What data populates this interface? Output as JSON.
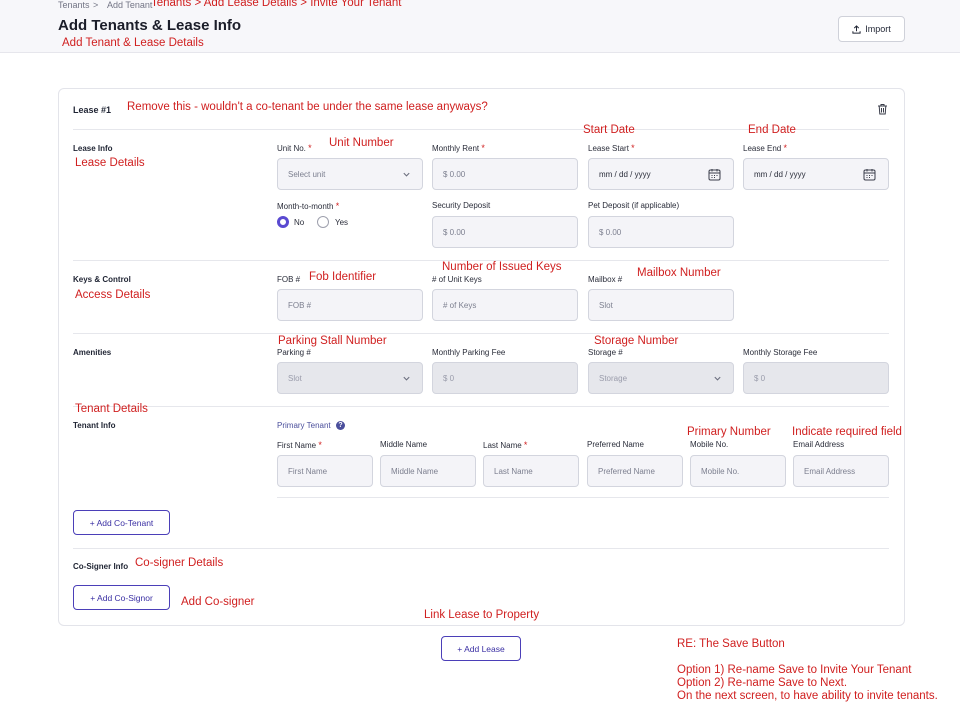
{
  "breadcrumb": {
    "item1": "Tenants",
    "sep": ">",
    "item2": "Add Tenant"
  },
  "header": {
    "title": "Add Tenants & Lease Info",
    "import_label": "Import"
  },
  "lease": {
    "title": "Lease #1",
    "sections": {
      "lease_info": "Lease Info",
      "keys": "Keys & Control",
      "amenities": "Amenities",
      "tenant_info": "Tenant Info",
      "cosigner_info": "Co-Signer Info"
    },
    "fields": {
      "unit": {
        "label": "Unit No.",
        "placeholder": "Select unit"
      },
      "rent": {
        "label": "Monthly Rent",
        "placeholder": "$ 0.00"
      },
      "lease_start": {
        "label": "Lease Start",
        "placeholder": "mm / dd / yyyy"
      },
      "lease_end": {
        "label": "Lease End",
        "placeholder": "mm / dd / yyyy"
      },
      "month_to_month": {
        "label": "Month-to-month",
        "options": [
          "No",
          "Yes"
        ],
        "selected": "No"
      },
      "security": {
        "label": "Security Deposit",
        "placeholder": "$ 0.00"
      },
      "pet": {
        "label": "Pet Deposit (if applicable)",
        "placeholder": "$ 0.00"
      },
      "fob": {
        "label": "FOB #",
        "placeholder": "FOB #"
      },
      "unit_keys": {
        "label": "# of Unit Keys",
        "placeholder": "# of Keys"
      },
      "mailbox": {
        "label": "Mailbox #",
        "placeholder": "Slot"
      },
      "parking": {
        "label": "Parking #",
        "placeholder": "Slot"
      },
      "parking_fee": {
        "label": "Monthly Parking Fee",
        "placeholder": "$ 0"
      },
      "storage": {
        "label": "Storage #",
        "placeholder": "Storage"
      },
      "storage_fee": {
        "label": "Monthly Storage Fee",
        "placeholder": "$ 0"
      },
      "primary_tenant": "Primary Tenant",
      "first_name": {
        "label": "First Name",
        "placeholder": "First Name"
      },
      "middle_name": {
        "label": "Middle Name",
        "placeholder": "Middle Name"
      },
      "last_name": {
        "label": "Last Name",
        "placeholder": "Last Name"
      },
      "preferred_name": {
        "label": "Preferred Name",
        "placeholder": "Preferred Name"
      },
      "mobile": {
        "label": "Mobile No.",
        "placeholder": "Mobile No."
      },
      "email": {
        "label": "Email Address",
        "placeholder": "Email Address"
      }
    },
    "buttons": {
      "add_cotenant": "+ Add Co-Tenant",
      "add_cosigner": "+ Add Co-Signor"
    }
  },
  "add_lease_label": "+ Add Lease",
  "annotations": {
    "breadcrumb_note": "Tenants > Add Lease Details > Invite Your Tenant",
    "title_note": "Add Tenant & Lease Details",
    "lease_note": "Remove this - wouldn't a co-tenant be under the same lease anyways?",
    "unit_number": "Unit Number",
    "start_date": "Start Date",
    "end_date": "End Date",
    "lease_details": "Lease Details",
    "fob_identifier": "Fob Identifier",
    "issued_keys": "Number of Issued Keys",
    "mailbox_number": "Mailbox Number",
    "access_details": "Access Details",
    "parking_stall": "Parking Stall Number",
    "storage_number": "Storage Number",
    "tenant_details": "Tenant Details",
    "primary_number": "Primary Number",
    "required_field": "Indicate required field",
    "cosigner_details": "Co-signer Details",
    "add_cosigner": "Add Co-signer",
    "link_lease": "Link Lease to Property",
    "save_title": "RE: The Save Button",
    "save_opt1": "Option 1) Re-name Save to Invite Your Tenant",
    "save_opt2": "Option 2) Re-name Save to Next.",
    "save_opt3": "On the next screen, to have ability to invite tenants."
  },
  "colors": {
    "accent": "#5a4ad1",
    "annotation": "#d02020",
    "required": "#d02020"
  }
}
